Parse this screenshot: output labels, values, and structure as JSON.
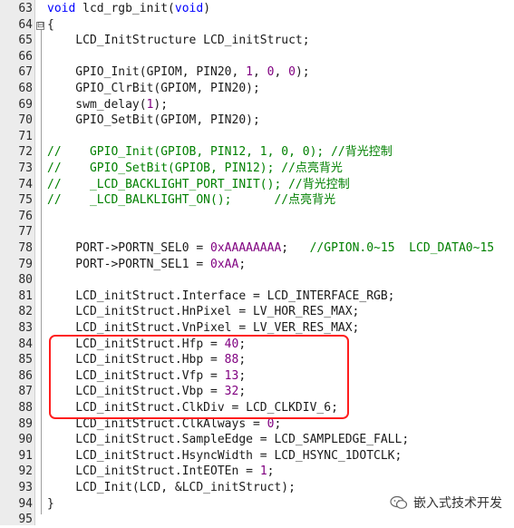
{
  "editor": {
    "lines": [
      {
        "no": "63",
        "fold": "",
        "segments": [
          {
            "t": "void",
            "c": "kw"
          },
          {
            "t": " lcd_rgb_init(",
            "c": ""
          },
          {
            "t": "void",
            "c": "kw"
          },
          {
            "t": ")",
            "c": ""
          }
        ]
      },
      {
        "no": "64",
        "fold": "⊟",
        "segments": [
          {
            "t": "{",
            "c": ""
          }
        ]
      },
      {
        "no": "65",
        "fold": "",
        "segments": [
          {
            "t": "    LCD_InitStructure LCD_initStruct;",
            "c": ""
          }
        ]
      },
      {
        "no": "66",
        "fold": "",
        "segments": []
      },
      {
        "no": "67",
        "fold": "",
        "segments": [
          {
            "t": "    GPIO_Init(GPIOM, PIN20, ",
            "c": ""
          },
          {
            "t": "1",
            "c": "num"
          },
          {
            "t": ", ",
            "c": ""
          },
          {
            "t": "0",
            "c": "num"
          },
          {
            "t": ", ",
            "c": ""
          },
          {
            "t": "0",
            "c": "num"
          },
          {
            "t": ");",
            "c": ""
          }
        ]
      },
      {
        "no": "68",
        "fold": "",
        "segments": [
          {
            "t": "    GPIO_ClrBit(GPIOM, PIN20);",
            "c": ""
          }
        ]
      },
      {
        "no": "69",
        "fold": "",
        "segments": [
          {
            "t": "    swm_delay(",
            "c": ""
          },
          {
            "t": "1",
            "c": "num"
          },
          {
            "t": ");",
            "c": ""
          }
        ]
      },
      {
        "no": "70",
        "fold": "",
        "segments": [
          {
            "t": "    GPIO_SetBit(GPIOM, PIN20);",
            "c": ""
          }
        ]
      },
      {
        "no": "71",
        "fold": "",
        "segments": []
      },
      {
        "no": "72",
        "fold": "",
        "segments": [
          {
            "t": "//    GPIO_Init(GPIOB, PIN12, 1, 0, 0); //背光控制",
            "c": "cm"
          }
        ]
      },
      {
        "no": "73",
        "fold": "",
        "segments": [
          {
            "t": "//    GPIO_SetBit(GPIOB, PIN12); //点亮背光",
            "c": "cm"
          }
        ]
      },
      {
        "no": "74",
        "fold": "",
        "segments": [
          {
            "t": "//    _LCD_BACKLIGHT_PORT_INIT(); //背光控制",
            "c": "cm"
          }
        ]
      },
      {
        "no": "75",
        "fold": "",
        "segments": [
          {
            "t": "//    _LCD_BALKLIGHT_ON();      //点亮背光",
            "c": "cm"
          }
        ]
      },
      {
        "no": "76",
        "fold": "",
        "segments": []
      },
      {
        "no": "77",
        "fold": "",
        "segments": []
      },
      {
        "no": "78",
        "fold": "",
        "segments": [
          {
            "t": "    PORT->PORTN_SEL0 = ",
            "c": ""
          },
          {
            "t": "0xAAAAAAAA",
            "c": "num"
          },
          {
            "t": ";   ",
            "c": ""
          },
          {
            "t": "//GPION.0~15  LCD_DATA0~15",
            "c": "cm"
          }
        ]
      },
      {
        "no": "79",
        "fold": "",
        "segments": [
          {
            "t": "    PORT->PORTN_SEL1 = ",
            "c": ""
          },
          {
            "t": "0xAA",
            "c": "num"
          },
          {
            "t": ";",
            "c": ""
          }
        ]
      },
      {
        "no": "80",
        "fold": "",
        "segments": []
      },
      {
        "no": "81",
        "fold": "",
        "segments": [
          {
            "t": "    LCD_initStruct.Interface = LCD_INTERFACE_RGB;",
            "c": ""
          }
        ]
      },
      {
        "no": "82",
        "fold": "",
        "segments": [
          {
            "t": "    LCD_initStruct.HnPixel = LV_HOR_RES_MAX;",
            "c": ""
          }
        ]
      },
      {
        "no": "83",
        "fold": "",
        "segments": [
          {
            "t": "    LCD_initStruct.VnPixel = LV_VER_RES_MAX;",
            "c": ""
          }
        ]
      },
      {
        "no": "84",
        "fold": "",
        "segments": [
          {
            "t": "    LCD_initStruct.Hfp = ",
            "c": ""
          },
          {
            "t": "40",
            "c": "num"
          },
          {
            "t": ";",
            "c": ""
          }
        ]
      },
      {
        "no": "85",
        "fold": "",
        "segments": [
          {
            "t": "    LCD_initStruct.Hbp = ",
            "c": ""
          },
          {
            "t": "88",
            "c": "num"
          },
          {
            "t": ";",
            "c": ""
          }
        ]
      },
      {
        "no": "86",
        "fold": "",
        "segments": [
          {
            "t": "    LCD_initStruct.Vfp = ",
            "c": ""
          },
          {
            "t": "13",
            "c": "num"
          },
          {
            "t": ";",
            "c": ""
          }
        ]
      },
      {
        "no": "87",
        "fold": "",
        "segments": [
          {
            "t": "    LCD_initStruct.Vbp = ",
            "c": ""
          },
          {
            "t": "32",
            "c": "num"
          },
          {
            "t": ";",
            "c": ""
          }
        ]
      },
      {
        "no": "88",
        "fold": "",
        "segments": [
          {
            "t": "    LCD_initStruct.ClkDiv = LCD_CLKDIV_6;",
            "c": ""
          }
        ]
      },
      {
        "no": "89",
        "fold": "",
        "segments": [
          {
            "t": "    LCD_initStruct.ClkAlways = ",
            "c": ""
          },
          {
            "t": "0",
            "c": "num"
          },
          {
            "t": ";",
            "c": ""
          }
        ]
      },
      {
        "no": "90",
        "fold": "",
        "segments": [
          {
            "t": "    LCD_initStruct.SampleEdge = LCD_SAMPLEDGE_FALL;",
            "c": ""
          }
        ]
      },
      {
        "no": "91",
        "fold": "",
        "segments": [
          {
            "t": "    LCD_initStruct.HsyncWidth = LCD_HSYNC_1DOTCLK;",
            "c": ""
          }
        ]
      },
      {
        "no": "92",
        "fold": "",
        "segments": [
          {
            "t": "    LCD_initStruct.IntEOTEn = ",
            "c": ""
          },
          {
            "t": "1",
            "c": "num"
          },
          {
            "t": ";",
            "c": ""
          }
        ]
      },
      {
        "no": "93",
        "fold": "",
        "segments": [
          {
            "t": "    LCD_Init(LCD, &LCD_initStruct);",
            "c": ""
          }
        ]
      },
      {
        "no": "94",
        "fold": "",
        "segments": [
          {
            "t": "}",
            "c": ""
          }
        ]
      },
      {
        "no": "95",
        "fold": "",
        "segments": []
      }
    ]
  },
  "watermark": {
    "text": "嵌入式技术开发",
    "icon": "wechat-icon"
  },
  "colors": {
    "keyword": "#0000ff",
    "number": "#800080",
    "comment": "#008000",
    "highlight_border": "#ff1e1e",
    "gutter": "#ececec"
  }
}
